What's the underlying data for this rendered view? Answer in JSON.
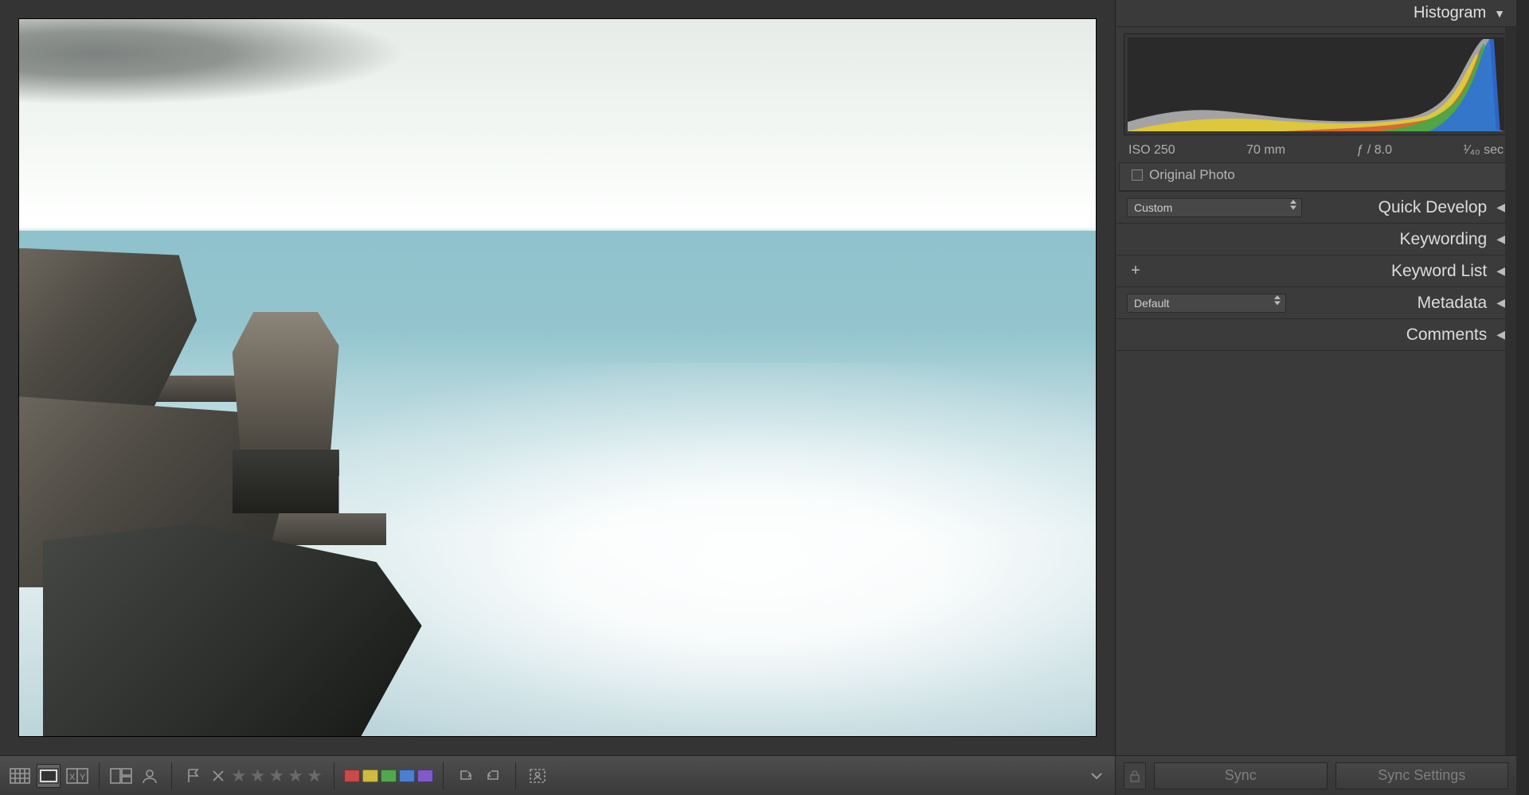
{
  "histogram_panel": {
    "title": "Histogram",
    "meta": {
      "iso": "ISO 250",
      "focal": "70 mm",
      "aperture": "ƒ / 8.0",
      "shutter": "¹⁄₄₀ sec"
    },
    "original_label": "Original Photo"
  },
  "sections": {
    "quick_develop": {
      "label": "Quick Develop",
      "preset": "Custom"
    },
    "keywording": {
      "label": "Keywording"
    },
    "keyword_list": {
      "label": "Keyword List"
    },
    "metadata": {
      "label": "Metadata",
      "preset": "Default"
    },
    "comments": {
      "label": "Comments"
    }
  },
  "footer": {
    "sync": "Sync",
    "sync_settings": "Sync Settings"
  },
  "toolbar": {
    "colors": [
      "#c94a4a",
      "#cdbb3f",
      "#52a84e",
      "#4a7fd1",
      "#7e5bc9"
    ]
  }
}
